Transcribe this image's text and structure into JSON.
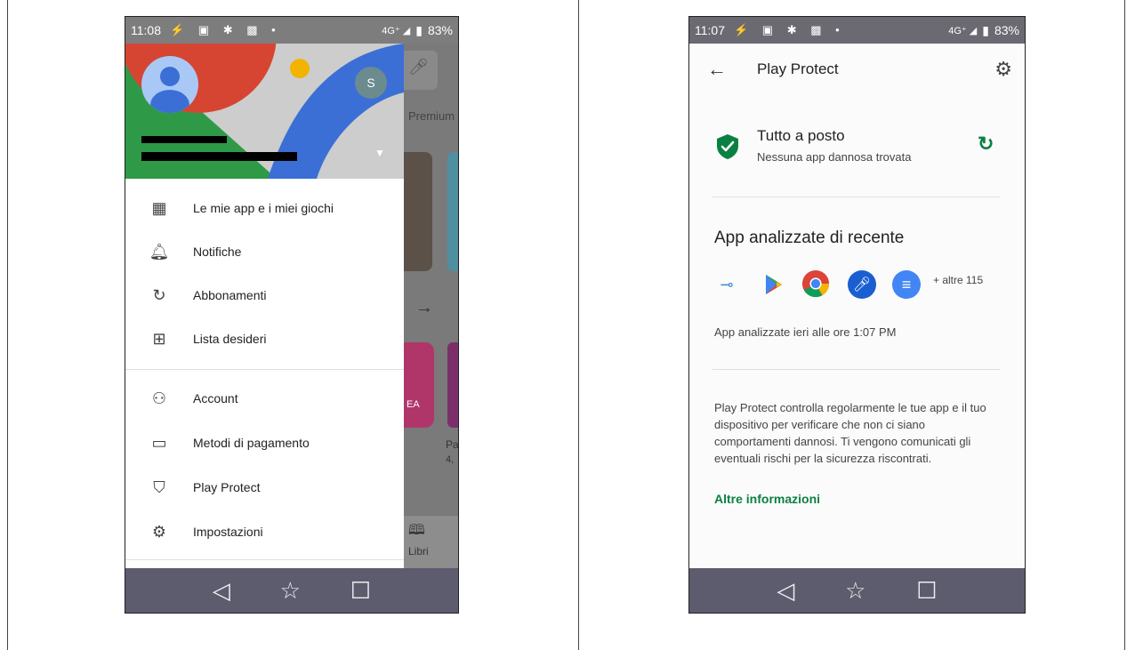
{
  "left_phone": {
    "status": {
      "time": "11:08",
      "icons": "⚡ ▣ ✱ ▩ •",
      "network": "4G⁺ ◢",
      "battery": "83%"
    },
    "header": {
      "avatar_small_letter": "S",
      "partial_email": "@"
    },
    "behind_drawer": {
      "premium_label": "Premium",
      "books_label": "Libri",
      "game_label": "Pa",
      "rating": "4,",
      "ea_badge": "EA"
    },
    "menu": [
      {
        "label": "Le mie app e i miei giochi",
        "icon": "apps-grid-icon",
        "glyph": "▦"
      },
      {
        "label": "Notifiche",
        "icon": "bell-icon",
        "glyph": "🔔︎"
      },
      {
        "label": "Abbonamenti",
        "icon": "subscriptions-refresh-icon",
        "glyph": "↻"
      },
      {
        "label": "Lista desideri",
        "icon": "wishlist-bookmark-icon",
        "glyph": "⊞"
      },
      {
        "label": "Account",
        "icon": "person-icon",
        "glyph": "⚇"
      },
      {
        "label": "Metodi di pagamento",
        "icon": "credit-card-icon",
        "glyph": "▭"
      },
      {
        "label": "Play Protect",
        "icon": "play-protect-shield-icon",
        "glyph": "⛉"
      },
      {
        "label": "Impostazioni",
        "icon": "settings-gear-icon",
        "glyph": "⚙"
      }
    ],
    "nav": {
      "back": "◁",
      "home": "☆",
      "recents": "☐"
    }
  },
  "right_phone": {
    "status": {
      "time": "11:07",
      "icons": "⚡ ▣ ✱ ▩ •",
      "network": "4G⁺ ◢",
      "battery": "83%"
    },
    "toolbar": {
      "back": "←",
      "title": "Play Protect",
      "settings": "⚙"
    },
    "status_card": {
      "title": "Tutto a posto",
      "subtitle": "Nessuna app dannosa trovata",
      "refresh": "↻"
    },
    "recent": {
      "title": "App analizzate di recente",
      "more": "+ altre 115",
      "scanned": "App analizzate ieri alle ore 1:07 PM",
      "apps": [
        "cast-app-icon",
        "play-store-icon",
        "chrome-icon",
        "voice-search-icon",
        "docs-icon"
      ]
    },
    "description": "Play Protect controlla regolarmente le tue app e il tuo dispositivo per verificare che non ci siano comportamenti dannosi. Ti vengono comunicati gli eventuali rischi per la sicurezza riscontrati.",
    "link": "Altre informazioni",
    "nav": {
      "back": "◁",
      "home": "☆",
      "recents": "☐"
    }
  },
  "colors": {
    "status_bg_left": "#7d7d7d",
    "status_bg_right": "#6b6a72",
    "accent_green": "#0b8043",
    "nav_bg": "#5d5b6e"
  }
}
